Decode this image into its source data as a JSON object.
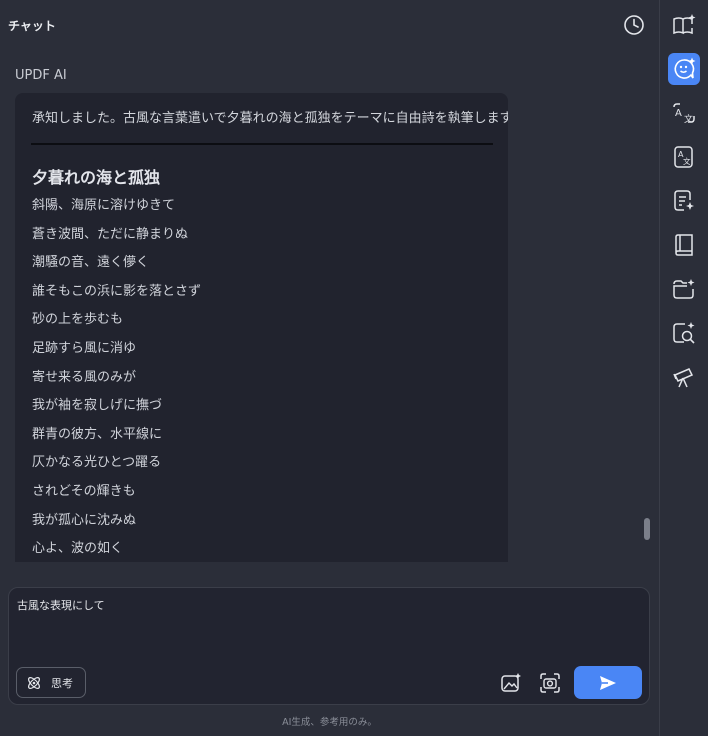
{
  "header": {
    "title": "チャット",
    "history_icon": "clock-icon"
  },
  "chat": {
    "sender": "UPDF AI",
    "intro": "承知しました。古風な言葉遣いで夕暮れの海と孤独をテーマに自由詩を執筆します。",
    "poem_title": "夕暮れの海と孤独",
    "poem_lines": [
      "斜陽、海原に溶けゆきて",
      "蒼き波間、ただに静まりぬ",
      "潮騒の音、遠く儚く",
      "誰そもこの浜に影を落とさず",
      "砂の上を歩むも",
      "足跡すら風に消ゆ",
      "寄せ来る風のみが",
      "我が袖を寂しげに撫づ",
      "群青の彼方、水平線に",
      "仄かなる光ひとつ躍る",
      "されどその輝きも",
      "我が孤心に沈みぬ",
      "心よ、波の如く"
    ]
  },
  "input": {
    "value": "古風な表現にして",
    "think_label": "思考",
    "think_icon": "atom-icon",
    "image_icon": "image-sparkle-icon",
    "screenshot_icon": "camera-icon",
    "send_icon": "send-icon"
  },
  "footer": {
    "disclaimer": "AI生成、参考用のみ。"
  },
  "toolbar": {
    "tools": [
      {
        "name": "book-sparkle-icon",
        "active": false
      },
      {
        "name": "ai-chat-icon",
        "active": true
      },
      {
        "name": "translate-icon",
        "active": false
      },
      {
        "name": "translate-document-icon",
        "active": false
      },
      {
        "name": "summary-icon",
        "active": false
      },
      {
        "name": "knowledge-base-icon",
        "active": false
      },
      {
        "name": "folder-sparkle-icon",
        "active": false
      },
      {
        "name": "search-sparkle-icon",
        "active": false
      },
      {
        "name": "telescope-icon",
        "active": false
      }
    ]
  },
  "colors": {
    "accent": "#4a86f5",
    "background": "#2b2e39",
    "bubble": "#21232e"
  }
}
